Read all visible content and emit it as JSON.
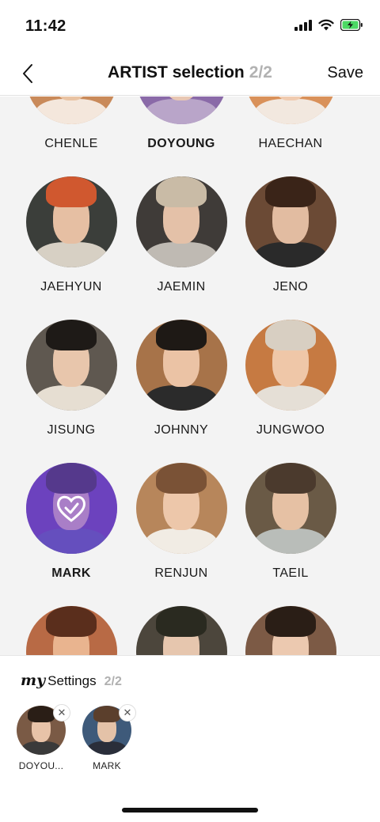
{
  "status": {
    "time": "11:42",
    "icons": [
      "cellular-signal-icon",
      "wifi-icon",
      "battery-charging-icon"
    ]
  },
  "header": {
    "back_icon": "chevron-left-icon",
    "title": "ARTIST selection",
    "count": "2/2",
    "save_label": "Save"
  },
  "artists": [
    {
      "name": "CHENLE",
      "selected": false
    },
    {
      "name": "DOYOUNG",
      "selected": true
    },
    {
      "name": "HAECHAN",
      "selected": false
    },
    {
      "name": "JAEHYUN",
      "selected": false
    },
    {
      "name": "JAEMIN",
      "selected": false
    },
    {
      "name": "JENO",
      "selected": false
    },
    {
      "name": "JISUNG",
      "selected": false
    },
    {
      "name": "JOHNNY",
      "selected": false
    },
    {
      "name": "JUNGWOO",
      "selected": false
    },
    {
      "name": "MARK",
      "selected": true
    },
    {
      "name": "RENJUN",
      "selected": false
    },
    {
      "name": "TAEIL",
      "selected": false
    }
  ],
  "selected_icon": "heart-check-icon",
  "my_settings": {
    "my_label": "my",
    "title": "Settings",
    "count": "2/2",
    "remove_icon": "close-icon",
    "remove_glyph": "✕",
    "chips": [
      {
        "name": "DOYOU..."
      },
      {
        "name": "MARK"
      }
    ]
  },
  "colors": {
    "accent_purple": "#7b4fe0",
    "grid_background": "#f3f3f3",
    "count_gray": "#b2b2b2"
  }
}
